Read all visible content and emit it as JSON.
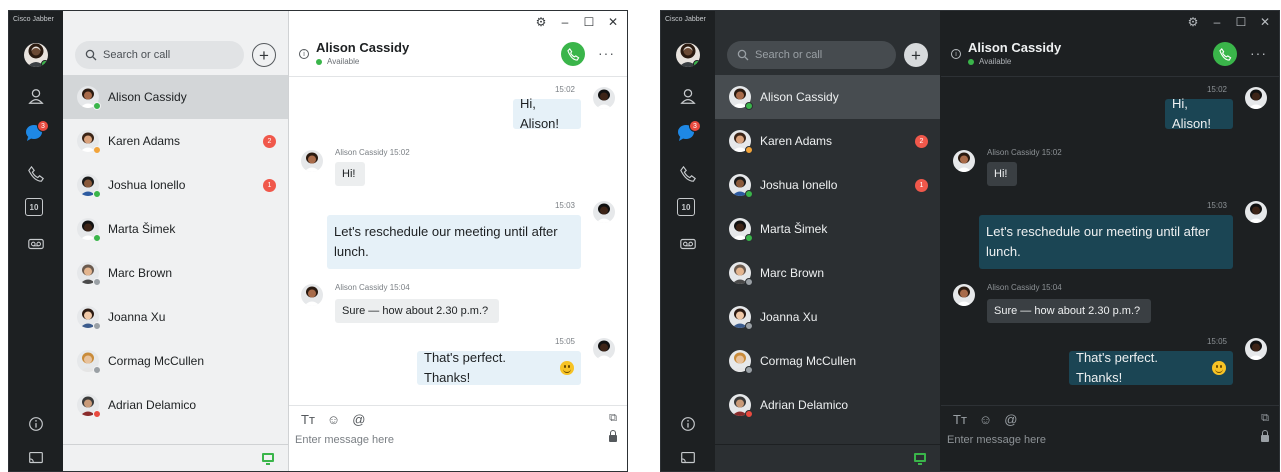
{
  "app": {
    "name": "Cisco Jabber"
  },
  "window_controls": [
    "⚙",
    "–",
    "☐",
    "✕"
  ],
  "rail": {
    "chat_badge": "3",
    "calendar_day": "10",
    "icons": [
      "person-icon",
      "chat-icon",
      "phone-icon",
      "calendar-icon",
      "voicemail-icon",
      "info-icon",
      "cast-icon"
    ]
  },
  "search": {
    "placeholder": "Search or call"
  },
  "contacts": [
    {
      "name": "Alison Cassidy",
      "status": "available",
      "selected": true,
      "badge": ""
    },
    {
      "name": "Karen Adams",
      "status": "away",
      "selected": false,
      "badge": "2"
    },
    {
      "name": "Joshua Ionello",
      "status": "available",
      "selected": false,
      "badge": "1"
    },
    {
      "name": "Marta Šimek",
      "status": "available",
      "selected": false,
      "badge": ""
    },
    {
      "name": "Marc Brown",
      "status": "offline",
      "selected": false,
      "badge": ""
    },
    {
      "name": "Joanna Xu",
      "status": "offline",
      "selected": false,
      "badge": ""
    },
    {
      "name": "Cormag McCullen",
      "status": "offline",
      "selected": false,
      "badge": ""
    },
    {
      "name": "Adrian Delamico",
      "status": "busy",
      "selected": false,
      "badge": ""
    }
  ],
  "conversation": {
    "name": "Alison Cassidy",
    "status": "Available",
    "messages": [
      {
        "dir": "out",
        "time": "15:02",
        "text": "Hi, Alison!"
      },
      {
        "dir": "in",
        "header": "Alison Cassidy 15:02",
        "text": "Hi!"
      },
      {
        "dir": "out",
        "time": "15:03",
        "text": "Let's reschedule our meeting until after lunch."
      },
      {
        "dir": "in",
        "header": "Alison Cassidy 15:04",
        "text": "Sure — how about 2.30 p.m.?"
      },
      {
        "dir": "out",
        "time": "15:05",
        "text": "That's perfect. Thanks!",
        "emoji": "smile-emoji"
      }
    ]
  },
  "compose": {
    "placeholder": "Enter message here",
    "tools": [
      "Tт",
      "☺",
      "@"
    ]
  },
  "colors": {
    "available": "#3ab54a",
    "away": "#f2a43a",
    "busy": "#e94a3f",
    "offline": "#9aa0a5",
    "badge": "#f0584b",
    "call": "#3ab54a"
  },
  "themes": [
    "light",
    "dark"
  ]
}
